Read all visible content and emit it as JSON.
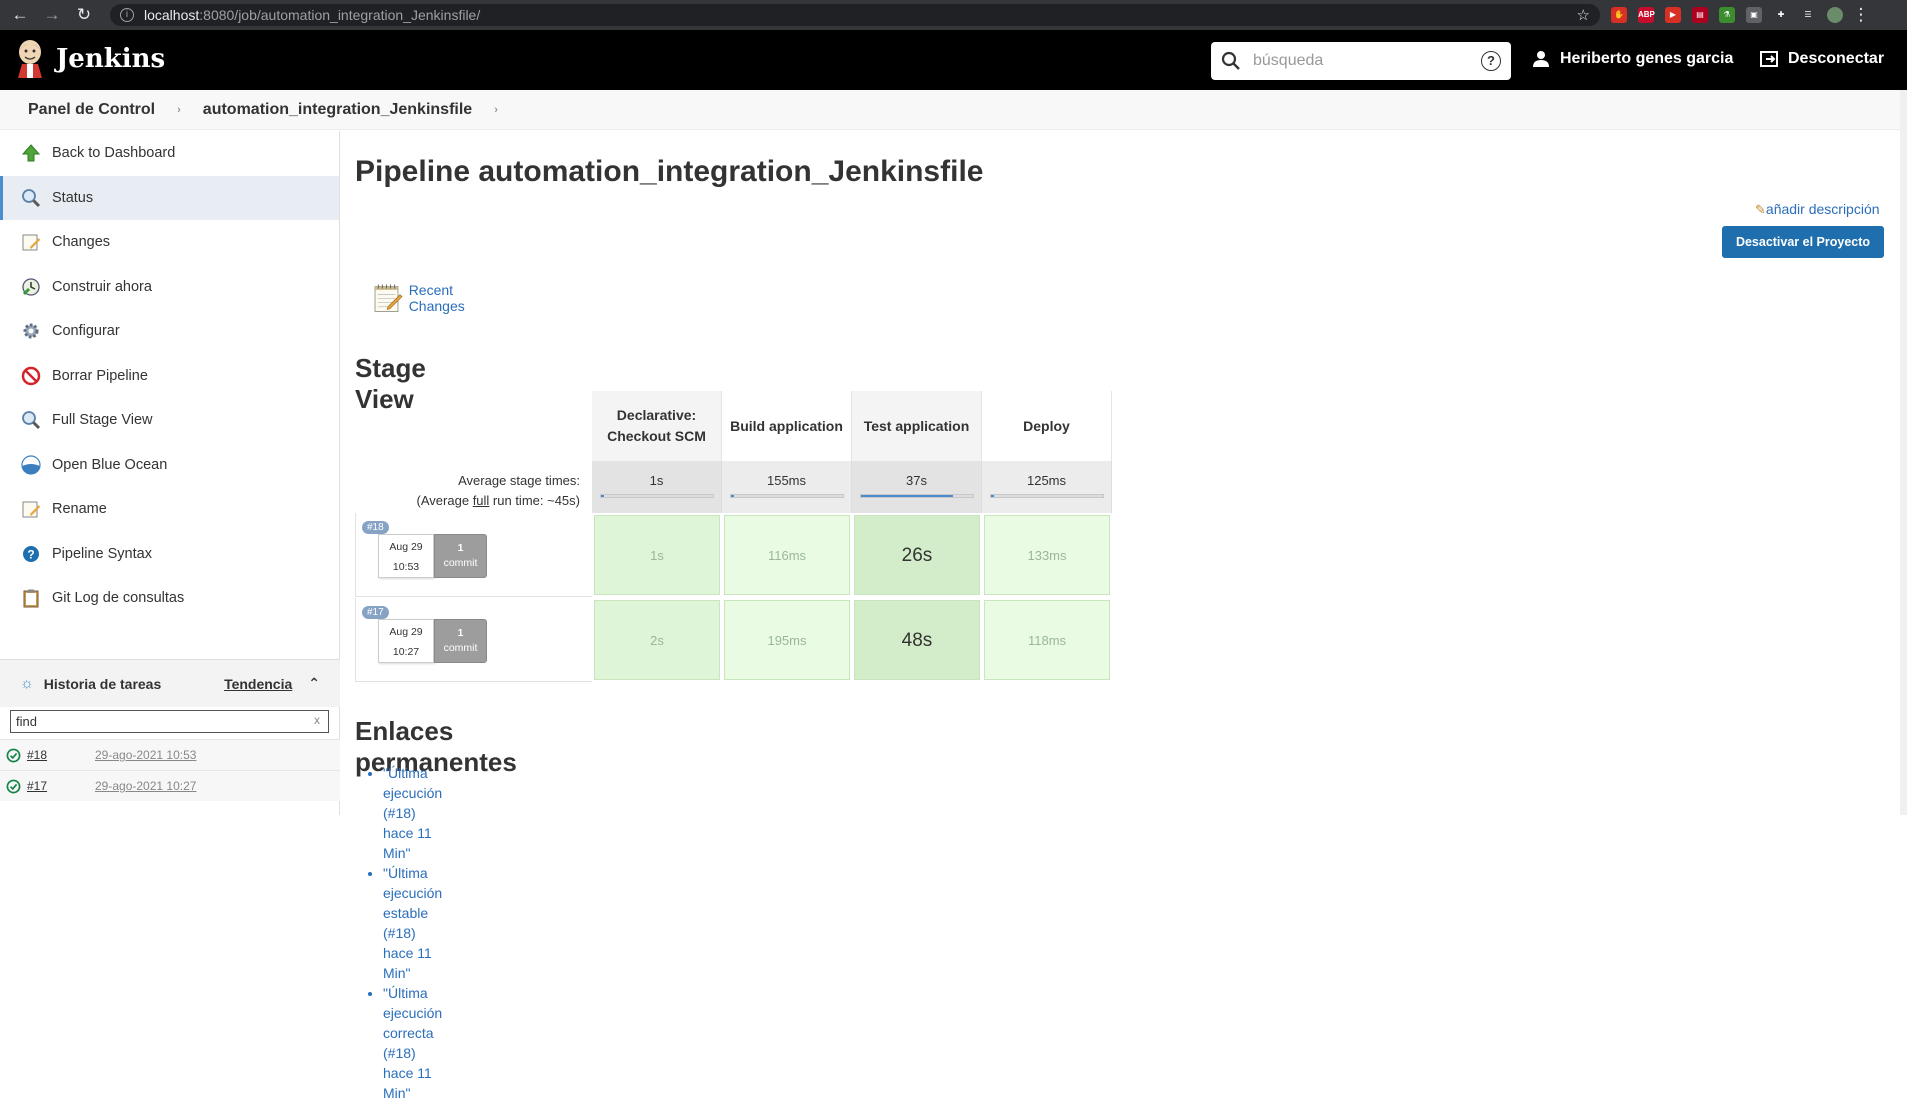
{
  "browser": {
    "url_host": "localhost",
    "url_path": ":8080/job/automation_integration_Jenkinsfile/",
    "extensions": [
      {
        "name": "adblock-icon",
        "color": "#d93025",
        "text": "✋"
      },
      {
        "name": "abp-icon",
        "color": "#c70d2c",
        "text": "ABP"
      },
      {
        "name": "video-ext-icon",
        "color": "#d93025",
        "text": "▶"
      },
      {
        "name": "pdf-ext-icon",
        "color": "#b00020",
        "text": "▤"
      },
      {
        "name": "flask-ext-icon",
        "color": "#3c8d2f",
        "text": "⚗"
      },
      {
        "name": "save-ext-icon",
        "color": "#5f6368",
        "text": "▣"
      },
      {
        "name": "puzzle-icon",
        "color": "#35363a",
        "text": "✚"
      },
      {
        "name": "reading-list-icon",
        "color": "#35363a",
        "text": "☰"
      },
      {
        "name": "profile-avatar-icon",
        "color": "#6a8c6a",
        "text": ""
      }
    ]
  },
  "header": {
    "brand": "Jenkins",
    "search_placeholder": "búsqueda",
    "user_name": "Heriberto genes garcia",
    "logout_label": "Desconectar"
  },
  "breadcrumb": {
    "items": [
      "Panel de Control",
      "automation_integration_Jenkinsfile"
    ]
  },
  "sidebar": {
    "items": [
      {
        "label": "Back to Dashboard",
        "icon": "up-arrow-icon"
      },
      {
        "label": "Status",
        "icon": "magnifier-icon"
      },
      {
        "label": "Changes",
        "icon": "notepad-icon"
      },
      {
        "label": "Construir ahora",
        "icon": "build-clock-icon"
      },
      {
        "label": "Configurar",
        "icon": "gear-icon"
      },
      {
        "label": "Borrar Pipeline",
        "icon": "no-entry-icon"
      },
      {
        "label": "Full Stage View",
        "icon": "magnifier-icon"
      },
      {
        "label": "Open Blue Ocean",
        "icon": "blue-ocean-icon"
      },
      {
        "label": "Rename",
        "icon": "notepad-icon"
      },
      {
        "label": "Pipeline Syntax",
        "icon": "help-icon"
      },
      {
        "label": "Git Log de consultas",
        "icon": "clipboard-icon"
      }
    ],
    "history_title": "Historia de tareas",
    "trend_label": "Tendencia",
    "find_value": "find",
    "history": [
      {
        "num": "#18",
        "date": "29-ago-2021 10:53"
      },
      {
        "num": "#17",
        "date": "29-ago-2021 10:27"
      }
    ]
  },
  "main": {
    "title": "Pipeline automation_integration_Jenkinsfile",
    "add_description": "añadir descripción",
    "disable_button": "Desactivar el Proyecto",
    "recent_changes": "Recent Changes",
    "stage_view_title": "Stage View",
    "avg_label_1": "Average stage times:",
    "avg_label_2a": "(Average ",
    "avg_label_full": "full",
    "avg_label_2b": " run time: ~45s)",
    "stages": [
      {
        "name": "Declarative: Checkout SCM",
        "avg": "1s",
        "avg_fill": 0.03
      },
      {
        "name": "Build application",
        "avg": "155ms",
        "avg_fill": 0.005
      },
      {
        "name": "Test application",
        "avg": "37s",
        "avg_fill": 0.82
      },
      {
        "name": "Deploy",
        "avg": "125ms",
        "avg_fill": 0.004
      }
    ],
    "runs": [
      {
        "badge": "#18",
        "date": "Aug 29",
        "time": "10:53",
        "commits_count": "1",
        "commits_word": "commit",
        "times": [
          "1s",
          "116ms",
          "26s",
          "133ms"
        ]
      },
      {
        "badge": "#17",
        "date": "Aug 29",
        "time": "10:27",
        "commits_count": "1",
        "commits_word": "commit",
        "times": [
          "2s",
          "195ms",
          "48s",
          "118ms"
        ]
      }
    ],
    "permalinks_title": "Enlaces permanentes",
    "permalinks": [
      "\"Última ejecución (#18) hace 11 Min\"",
      "\"Última ejecución estable (#18) hace 11 Min\"",
      "\"Última ejecución correcta (#18) hace 11 Min\""
    ]
  }
}
